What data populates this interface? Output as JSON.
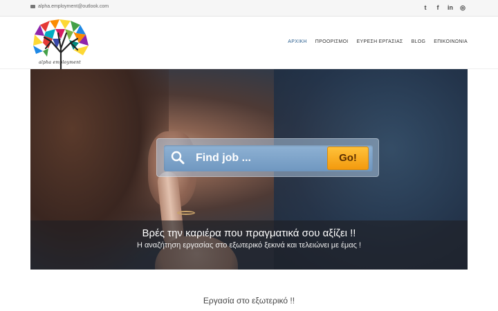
{
  "topbar": {
    "email": "alpha.employment@outlook.com",
    "socials": [
      {
        "icon": "twitter-icon",
        "glyph": "t"
      },
      {
        "icon": "facebook-icon",
        "glyph": "f"
      },
      {
        "icon": "linkedin-icon",
        "glyph": "in"
      },
      {
        "icon": "instagram-icon",
        "glyph": "◎"
      }
    ]
  },
  "header": {
    "logo_text": "alpha employment",
    "nav": [
      {
        "label": "ΑΡΧΙΚΗ",
        "active": true
      },
      {
        "label": "ΠΡΟΟΡΙΣΜΟΙ",
        "active": false
      },
      {
        "label": "ΕΥΡΕΣΗ ΕΡΓΑΣΙΑΣ",
        "active": false
      },
      {
        "label": "BLOG",
        "active": false
      },
      {
        "label": "ΕΠΙΚΟΙΝΩΝΙΑ",
        "active": false
      }
    ]
  },
  "hero": {
    "search_placeholder": "Find job ...",
    "go_label": "Go!",
    "title": "Βρές την καριέρα που πραγματικά σου αξίζει !!",
    "subtitle": "Η αναζήτηση εργασίας στο εξωτερικό ξεκινά και τελειώνει με έμας !"
  },
  "section": {
    "title": "Εργασία στο εξωτερικό !!"
  },
  "colors": {
    "accent": "#2b5f8f",
    "go_button": "#f39a0e"
  }
}
